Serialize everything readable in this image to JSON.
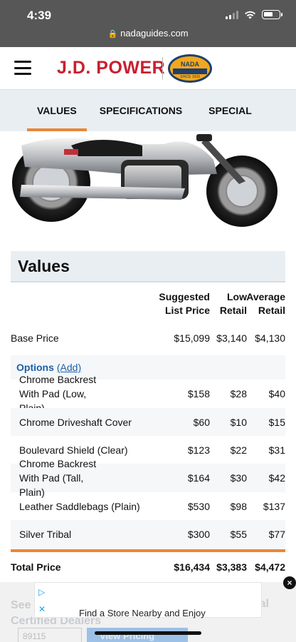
{
  "status": {
    "time": "4:39"
  },
  "browser": {
    "url": "nadaguides.com"
  },
  "header": {
    "brand": "J.D. POWER",
    "nada_top": "NADA",
    "nada_bottom": "SINCE 1933"
  },
  "tabs": [
    {
      "label": "VALUES",
      "active": true
    },
    {
      "label": "SPECIFICATIONS",
      "active": false
    },
    {
      "label": "SPECIAL NOTES",
      "active": false
    }
  ],
  "values": {
    "heading": "Values",
    "columns": {
      "suggested_line1": "Suggested",
      "suggested_line2": "List Price",
      "low_line1": "Low",
      "low_line2": "Retail",
      "avg_line1": "Average",
      "avg_line2": "Retail"
    },
    "base": {
      "name": "Base Price",
      "list": "$15,099",
      "low": "$3,140",
      "avg": "$4,130"
    },
    "options_label": "Options",
    "options_add": "(Add)",
    "options": [
      {
        "name": "Chrome Backrest With Pad (Low, Plain)",
        "list": "$158",
        "low": "$28",
        "avg": "$40"
      },
      {
        "name": "Chrome Driveshaft Cover",
        "list": "$60",
        "low": "$10",
        "avg": "$15"
      },
      {
        "name": "Boulevard Shield (Clear)",
        "list": "$123",
        "low": "$22",
        "avg": "$31"
      },
      {
        "name": "Chrome Backrest With Pad (Tall, Plain)",
        "list": "$164",
        "low": "$30",
        "avg": "$42"
      },
      {
        "name": "Leather Saddlebags (Plain)",
        "list": "$530",
        "low": "$98",
        "avg": "$137"
      },
      {
        "name": "Silver Tribal",
        "list": "$300",
        "low": "$55",
        "avg": "$77"
      }
    ],
    "total": {
      "name": "Total Price",
      "list": "$16,434",
      "low": "$3,383",
      "avg": "$4,472"
    }
  },
  "bottom": {
    "faded_line1": "See",
    "faded_line1_right": "al",
    "faded_line2": "Certified Dealers",
    "zip": "89115",
    "button": "View Pricing"
  },
  "ad": {
    "text": "Find a Store Nearby and Enjoy",
    "close": "×"
  },
  "colors": {
    "accent_orange": "#e8873a",
    "brand_red": "#c8202f",
    "link_blue": "#1d5fa8"
  }
}
